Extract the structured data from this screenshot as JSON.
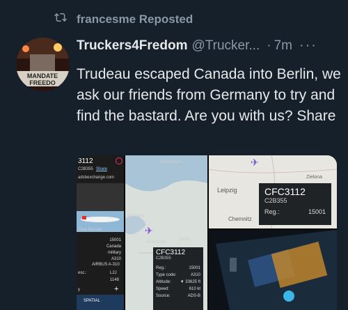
{
  "repost": {
    "text": "francesme Reposted",
    "icon": "repost-icon"
  },
  "author": {
    "name": "Truckers4Fredom",
    "handle": "@Trucker...",
    "time": "7m",
    "more": "···",
    "avatar_text_1": "MANDATE",
    "avatar_text_2": "FREEDO"
  },
  "tweet": {
    "text": "Trudeau escaped Canada into Berlin, we ask our friends from Germany to try and find the bastard. Are you with us? Share"
  },
  "media": {
    "panel1": {
      "callsign": "3112",
      "sub": "C2B355",
      "share": "Share",
      "site": "adsbexchange.com",
      "tag": "Timo Dessier",
      "rows": [
        "15001",
        "Canada",
        "military",
        "A310",
        "AIRBUS A-310",
        "L2J",
        "1148"
      ],
      "labels": [
        "esc.:",
        "y"
      ],
      "footer": "SPATIAL"
    },
    "panel2": {
      "cities": [
        "Kobenhavn",
        "Berlin",
        "Wolfsburg",
        "Hamburg"
      ],
      "callsign": "CFC3112",
      "sub": "C2B355",
      "rows": [
        [
          "Reg.:",
          "15001"
        ],
        [
          "Type code:",
          "A310"
        ],
        [
          "Altitude:",
          "▼ 33625 ft"
        ],
        [
          "Speed:",
          "610 kt"
        ],
        [
          "Source:",
          "ADS-B"
        ]
      ]
    },
    "panel3": {
      "cities": [
        "Zielona",
        "Leipzig",
        "Chemnitz"
      ],
      "callsign": "CFC3112",
      "sub": "C2B355",
      "reg_label": "Reg.:",
      "reg_value": "15001"
    }
  }
}
